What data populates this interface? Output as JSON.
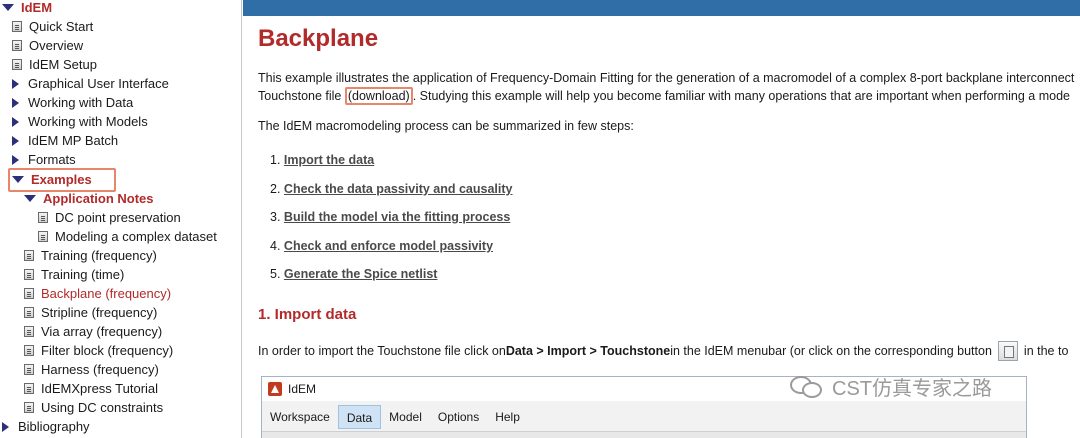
{
  "sidebar": {
    "root": "IdEM",
    "items": [
      {
        "label": "Quick Start"
      },
      {
        "label": "Overview"
      },
      {
        "label": "IdEM Setup"
      },
      {
        "label": "Graphical User Interface"
      },
      {
        "label": "Working with Data"
      },
      {
        "label": "Working with Models"
      },
      {
        "label": "IdEM MP Batch"
      },
      {
        "label": "Formats"
      },
      {
        "label": "Examples"
      },
      {
        "label": "Application Notes"
      },
      {
        "label": "DC point preservation"
      },
      {
        "label": "Modeling a complex dataset"
      },
      {
        "label": "Training (frequency)"
      },
      {
        "label": "Training (time)"
      },
      {
        "label": "Backplane (frequency)"
      },
      {
        "label": "Stripline (frequency)"
      },
      {
        "label": "Via array (frequency)"
      },
      {
        "label": "Filter block (frequency)"
      },
      {
        "label": "Harness (frequency)"
      },
      {
        "label": "IdEMXpress Tutorial"
      },
      {
        "label": "Using DC constraints"
      },
      {
        "label": "Bibliography"
      }
    ]
  },
  "main": {
    "title": "Backplane",
    "intro_line1": "This example illustrates the application of Frequency-Domain Fitting for the generation of a macromodel of a complex 8-port backplane interconnect",
    "intro_line2_pre": "Touchstone file ",
    "intro_link": "(download)",
    "intro_line2_post": ". Studying this example will help you become familiar with many operations that are important when performing a mode",
    "summary": "The IdEM macromodeling process can be summarized in few steps:",
    "steps": [
      {
        "num": "1.",
        "label": "Import the data"
      },
      {
        "num": "2.",
        "label": "Check the data passivity and causality"
      },
      {
        "num": "3.",
        "label": "Build the model via the fitting process"
      },
      {
        "num": "4.",
        "label": "Check and enforce model passivity"
      },
      {
        "num": "5.",
        "label": "Generate the Spice netlist"
      }
    ],
    "section1_title": "1. Import data",
    "import_pre": "In order to import the Touchstone file click on ",
    "import_bold": "Data > Import > Touchstone",
    "import_mid": " in the IdEM menubar (or click on the corresponding button ",
    "import_post": " in the to"
  },
  "app_window": {
    "title": "IdEM",
    "menu": [
      "Workspace",
      "Data",
      "Model",
      "Options",
      "Help"
    ],
    "active_menu": "Data"
  },
  "watermark": {
    "text": "CST仿真专家之路"
  },
  "colors": {
    "accent_red": "#b22a2a",
    "highlight": "#e8866a",
    "header_blue": "#2f6ea6"
  }
}
